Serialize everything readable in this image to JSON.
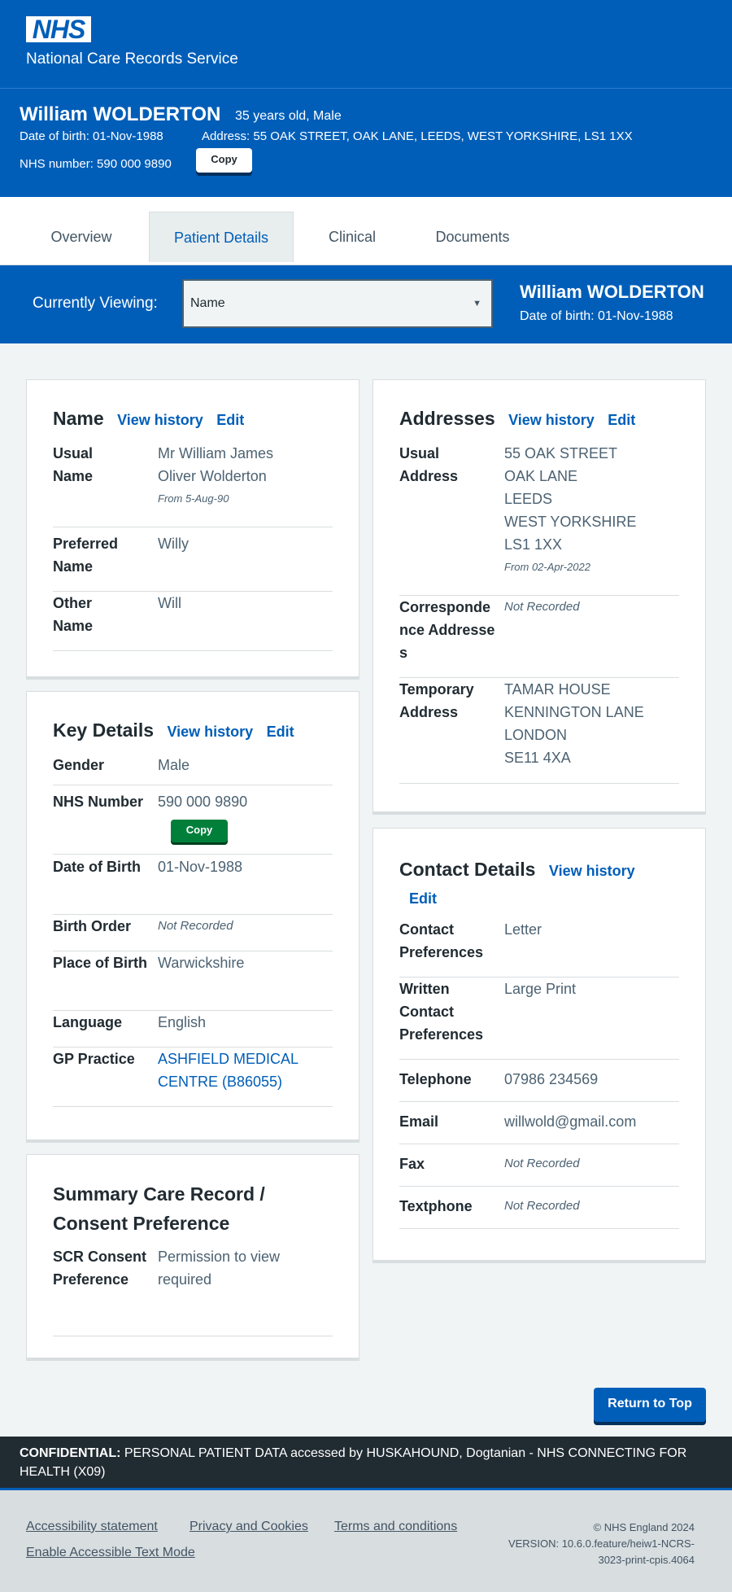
{
  "header": {
    "logo": "NHS",
    "service": "National Care Records Service"
  },
  "banner": {
    "name": "William WOLDERTON",
    "age_sex": "35 years old, Male",
    "dob": "Date of birth: 01-Nov-1988",
    "address": "Address: 55 OAK STREET, OAK LANE, LEEDS, WEST YORKSHIRE, LS1 1XX",
    "nhs_number": "NHS number: 590 000 9890",
    "copy_label": "Copy"
  },
  "tabs": [
    {
      "label": "Overview"
    },
    {
      "label": "Patient Details",
      "active": true
    },
    {
      "label": "Clinical"
    },
    {
      "label": "Documents"
    }
  ],
  "viewbar": {
    "label": "Currently Viewing:",
    "selected": "Name",
    "name": "William WOLDERTON",
    "dob": "Date of birth: 01-Nov-1988"
  },
  "name_card": {
    "title": "Name",
    "history": "View history",
    "edit": "Edit",
    "rows": [
      {
        "key": "Usual Name",
        "value": "Mr William James Oliver Wolderton",
        "from": "From 5-Aug-90"
      },
      {
        "key": "Preferred Name",
        "value": "Willy"
      },
      {
        "key": "Other Name",
        "value": "Will"
      }
    ]
  },
  "key_card": {
    "title": "Key Details",
    "history": "View history",
    "edit": "Edit",
    "rows": [
      {
        "key": "Gender",
        "value": "Male"
      },
      {
        "key": "NHS Number",
        "value": "590 000 9890",
        "copy": "Copy"
      },
      {
        "key": "Date of Birth",
        "value": "01-Nov-1988"
      },
      {
        "key": "Birth Order",
        "value": "Not Recorded"
      },
      {
        "key": "Place of Birth",
        "value": "Warwickshire"
      },
      {
        "key": "Language",
        "value": "English"
      },
      {
        "key": "GP Practice",
        "value": "ASHFIELD MEDICAL CENTRE (B86055)"
      }
    ]
  },
  "scr_card": {
    "title": "Summary Care Record / Consent Preference",
    "rows": [
      {
        "key": "SCR Consent Preference",
        "value": "Permission to view required"
      }
    ]
  },
  "address_card": {
    "title": "Addresses",
    "history": "View history",
    "edit": "Edit",
    "rows": [
      {
        "key": "Usual Address",
        "lines": [
          "55 OAK STREET",
          "OAK LANE",
          "LEEDS",
          "WEST YORKSHIRE",
          "LS1 1XX"
        ],
        "from": "From 02-Apr-2022"
      },
      {
        "key": "Correspondence Addresses",
        "value": "Not Recorded"
      },
      {
        "key": "Temporary Address",
        "lines": [
          "TAMAR HOUSE",
          "KENNINGTON LANE",
          "LONDON",
          "SE11 4XA"
        ]
      }
    ]
  },
  "contact_card": {
    "title": "Contact Details",
    "history": "View history",
    "edit": "Edit",
    "rows": [
      {
        "key": "Contact Preferences",
        "value": "Letter"
      },
      {
        "key": "Written Contact Preferences",
        "value": "Large Print"
      },
      {
        "key": "Telephone",
        "value": "07986 234569"
      },
      {
        "key": "Email",
        "value": "willwold@gmail.com"
      },
      {
        "key": "Fax",
        "value": "Not Recorded"
      },
      {
        "key": "Textphone",
        "value": "Not Recorded"
      }
    ]
  },
  "return_top": "Return to Top",
  "confidential": {
    "label": "CONFIDENTIAL:",
    "text": " PERSONAL PATIENT DATA accessed by HUSKAHOUND, Dogtanian - NHS CONNECTING FOR HEALTH (X09)"
  },
  "footer": {
    "links": [
      "Accessibility statement",
      "Privacy and Cookies",
      "Terms and conditions",
      "Enable Accessible Text Mode"
    ],
    "copyright": "© NHS England 2024",
    "version": "VERSION: 10.6.0.feature/heiw1-NCRS-3023-print-cpis.4064"
  }
}
